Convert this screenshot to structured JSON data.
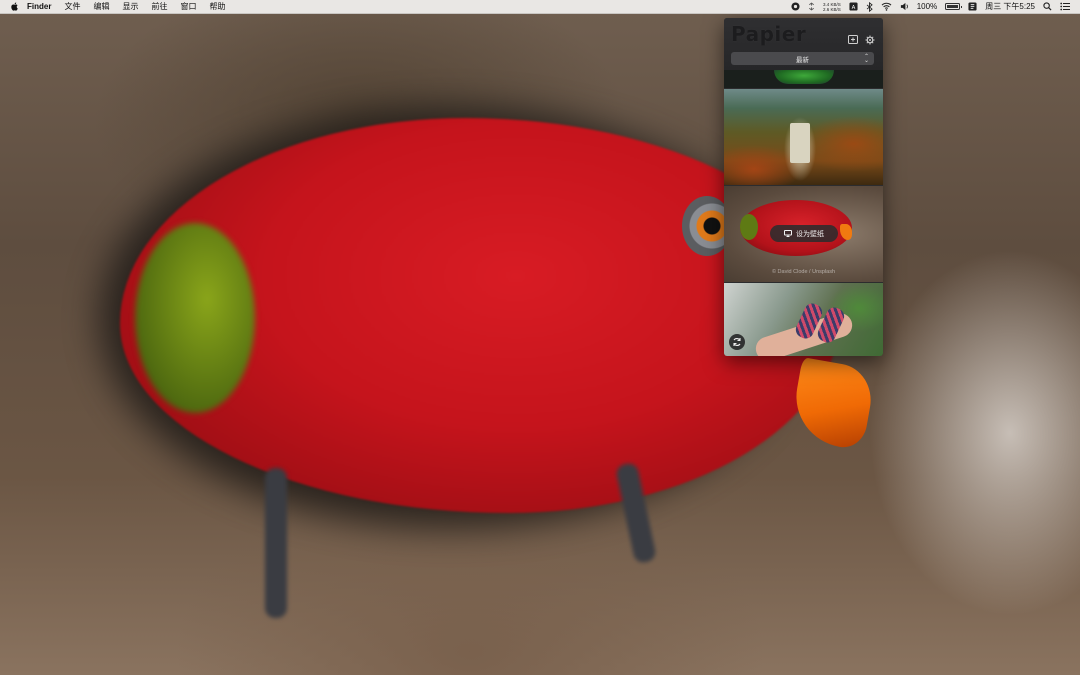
{
  "menubar": {
    "app_name": "Finder",
    "menus": [
      "文件",
      "编辑",
      "显示",
      "前往",
      "窗口",
      "帮助"
    ],
    "status": {
      "net_up": "3.4 KB/S",
      "net_down": "2.6 KB/S",
      "battery_percent": "100%",
      "battery_level": 1.0,
      "clock": "周三 下午5:25"
    },
    "icons": [
      "papier-menubar-icon",
      "sync-icon",
      "ime-icon",
      "bluetooth-icon",
      "wifi-icon",
      "volume-icon",
      "battery-icon",
      "input-source-icon",
      "spotlight-icon",
      "notification-center-icon"
    ]
  },
  "popover": {
    "app_title": "Papier",
    "sort_selected": "最新",
    "set_wallpaper_label": "设为壁纸",
    "photo_credit": "© David Clode / Unsplash",
    "header_icons": [
      "add-to-desktop-icon",
      "gear-icon"
    ]
  },
  "colors": {
    "menubar_bg": "#e9e7e4",
    "popover_bg": "#2c2c2e",
    "accent_red": "#c5141c"
  }
}
